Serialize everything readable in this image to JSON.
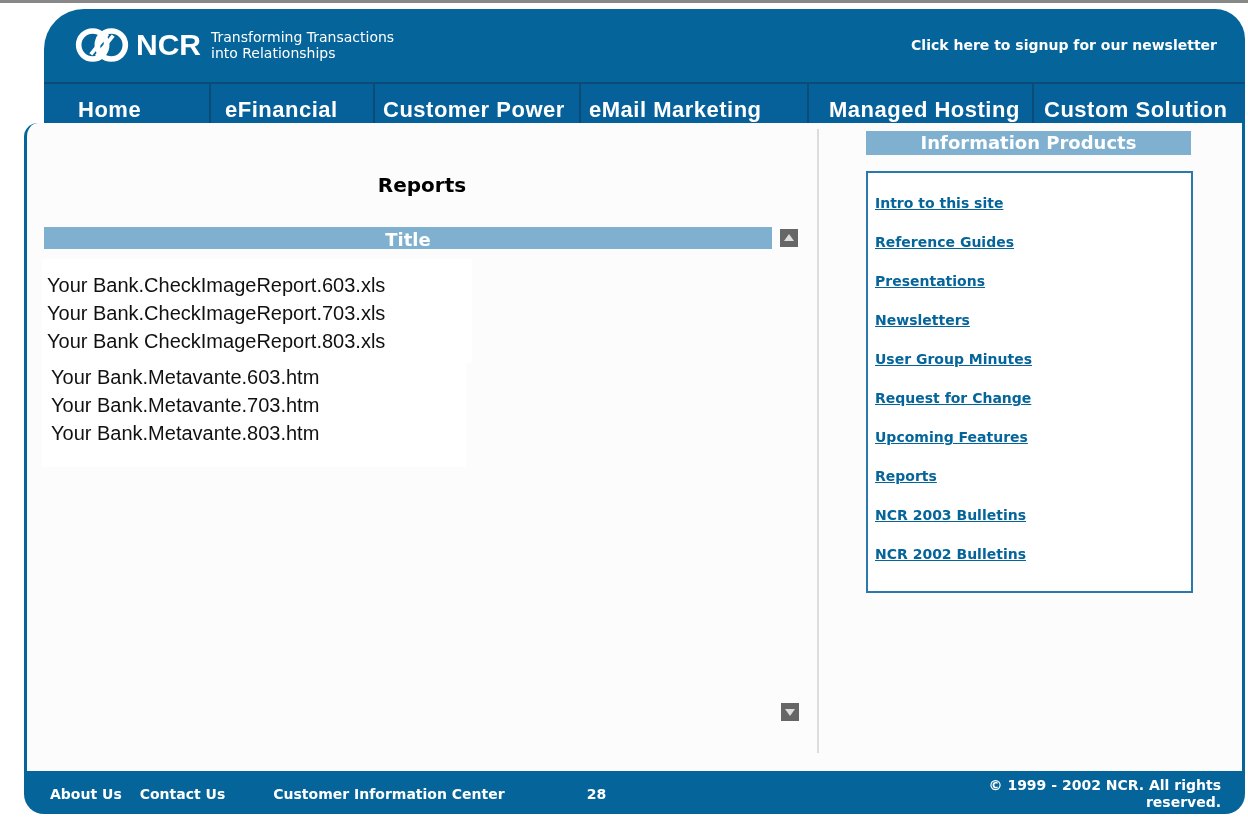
{
  "header": {
    "brand": "NCR",
    "tagline": [
      "Transforming Transactions",
      "into Relationships"
    ],
    "newsletter_link": "Click here to signup for our newsletter"
  },
  "nav": [
    {
      "label": "Home"
    },
    {
      "label": "eFinancial"
    },
    {
      "label": "Customer Power"
    },
    {
      "label": "eMail Marketing"
    },
    {
      "label": "Managed Hosting"
    },
    {
      "label": "Custom Solution"
    }
  ],
  "main": {
    "heading": "Reports",
    "column_header": "Title",
    "file_groups": [
      [
        "Your Bank.CheckImageReport.603.xls",
        "Your Bank.CheckImageReport.703.xls",
        "Your Bank CheckImageReport.803.xls"
      ],
      [
        "Your Bank.Metavante.603.htm",
        "Your Bank.Metavante.703.htm",
        "Your Bank.Metavante.803.htm"
      ]
    ]
  },
  "sidebar": {
    "title": "Information Products",
    "links": [
      "Intro to this site",
      "Reference Guides",
      "Presentations",
      "Newsletters",
      "User Group Minutes",
      "Request for Change",
      "Upcoming Features",
      "Reports",
      "NCR 2003 Bulletins",
      "NCR 2002 Bulletins"
    ]
  },
  "footer": {
    "links": [
      "About Us",
      "Contact Us",
      "Customer Information Center"
    ],
    "counter": "28",
    "copyright": "© 1999 - 2002 NCR. All rights reserved."
  }
}
